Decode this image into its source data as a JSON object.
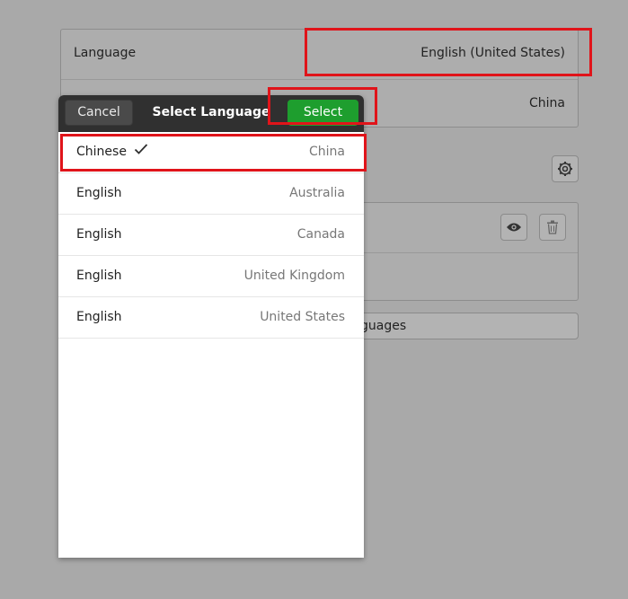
{
  "settings": {
    "language_label": "Language",
    "language_value": "English (United States)",
    "formats_value": "China",
    "manage_languages_label": "Manage Installed Languages",
    "manage_languages_visible": "guages"
  },
  "dialog": {
    "title": "Select Language",
    "cancel_label": "Cancel",
    "select_label": "Select",
    "select_color": "#1e9e2e",
    "items": [
      {
        "language": "Chinese",
        "country": "China",
        "selected": true
      },
      {
        "language": "English",
        "country": "Australia"
      },
      {
        "language": "English",
        "country": "Canada"
      },
      {
        "language": "English",
        "country": "United Kingdom"
      },
      {
        "language": "English",
        "country": "United States"
      }
    ]
  },
  "highlight_color": "#e0141a"
}
